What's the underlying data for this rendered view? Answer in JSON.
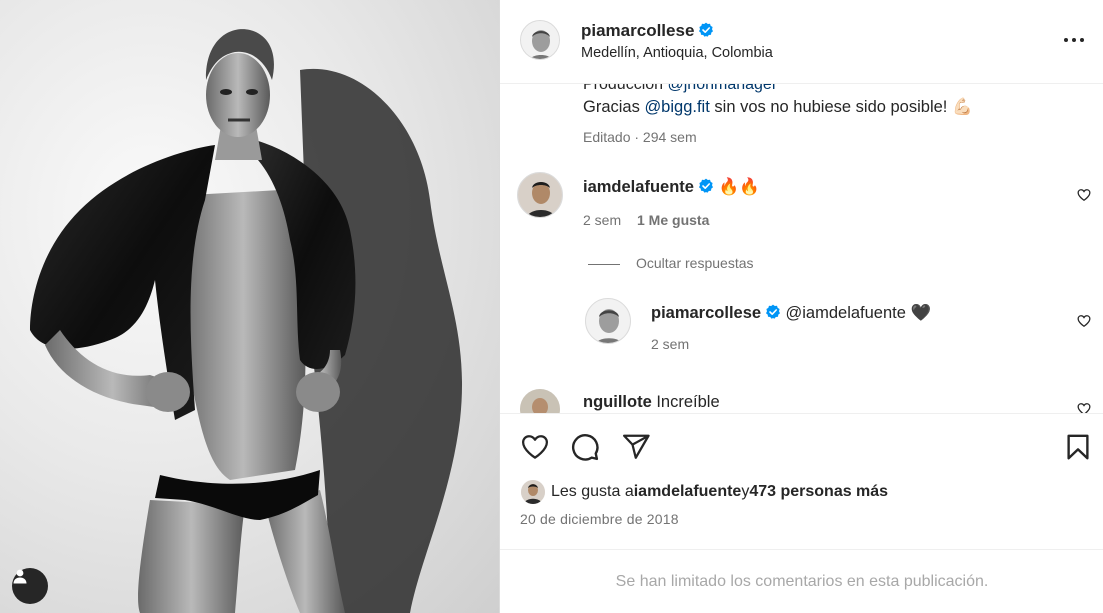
{
  "post": {
    "username": "piamarcollese",
    "location": "Medellín, Antioquia, Colombia"
  },
  "caption": {
    "cut_prefix": "Producción ",
    "cut_mention": "@jhonmanager",
    "line_prefix": "Gracias ",
    "line_mention": "@bigg.fit",
    "line_suffix": " sin vos no hubiese sido posible! 💪🏻",
    "meta": "Editado · 294 sem"
  },
  "comments": [
    {
      "username": "iamdelafuente",
      "text": " 🔥🔥",
      "time": "2 sem",
      "likes": "1 Me gusta"
    },
    {
      "username": "nguillote",
      "text": " Increíble"
    }
  ],
  "replies": {
    "toggle_label": "Ocultar respuestas",
    "items": [
      {
        "username": "piamarcollese",
        "mention": "@iamdelafuente",
        "text": " 🖤",
        "time": "2 sem"
      }
    ]
  },
  "likes": {
    "prefix": "Les gusta a ",
    "user": "iamdelafuente",
    "middle": " y ",
    "count": "473 personas más"
  },
  "date": "20 de diciembre de 2018",
  "comments_limited": "Se han limitado los comentarios en esta publicación.",
  "colors": {
    "verified": "#0095f6",
    "mention": "#00376b",
    "secondary_text": "#737373"
  },
  "icons": [
    "heart-icon",
    "comment-icon",
    "share-icon",
    "bookmark-icon",
    "more-options-icon",
    "verified-badge-icon",
    "user-tag-icon"
  ]
}
